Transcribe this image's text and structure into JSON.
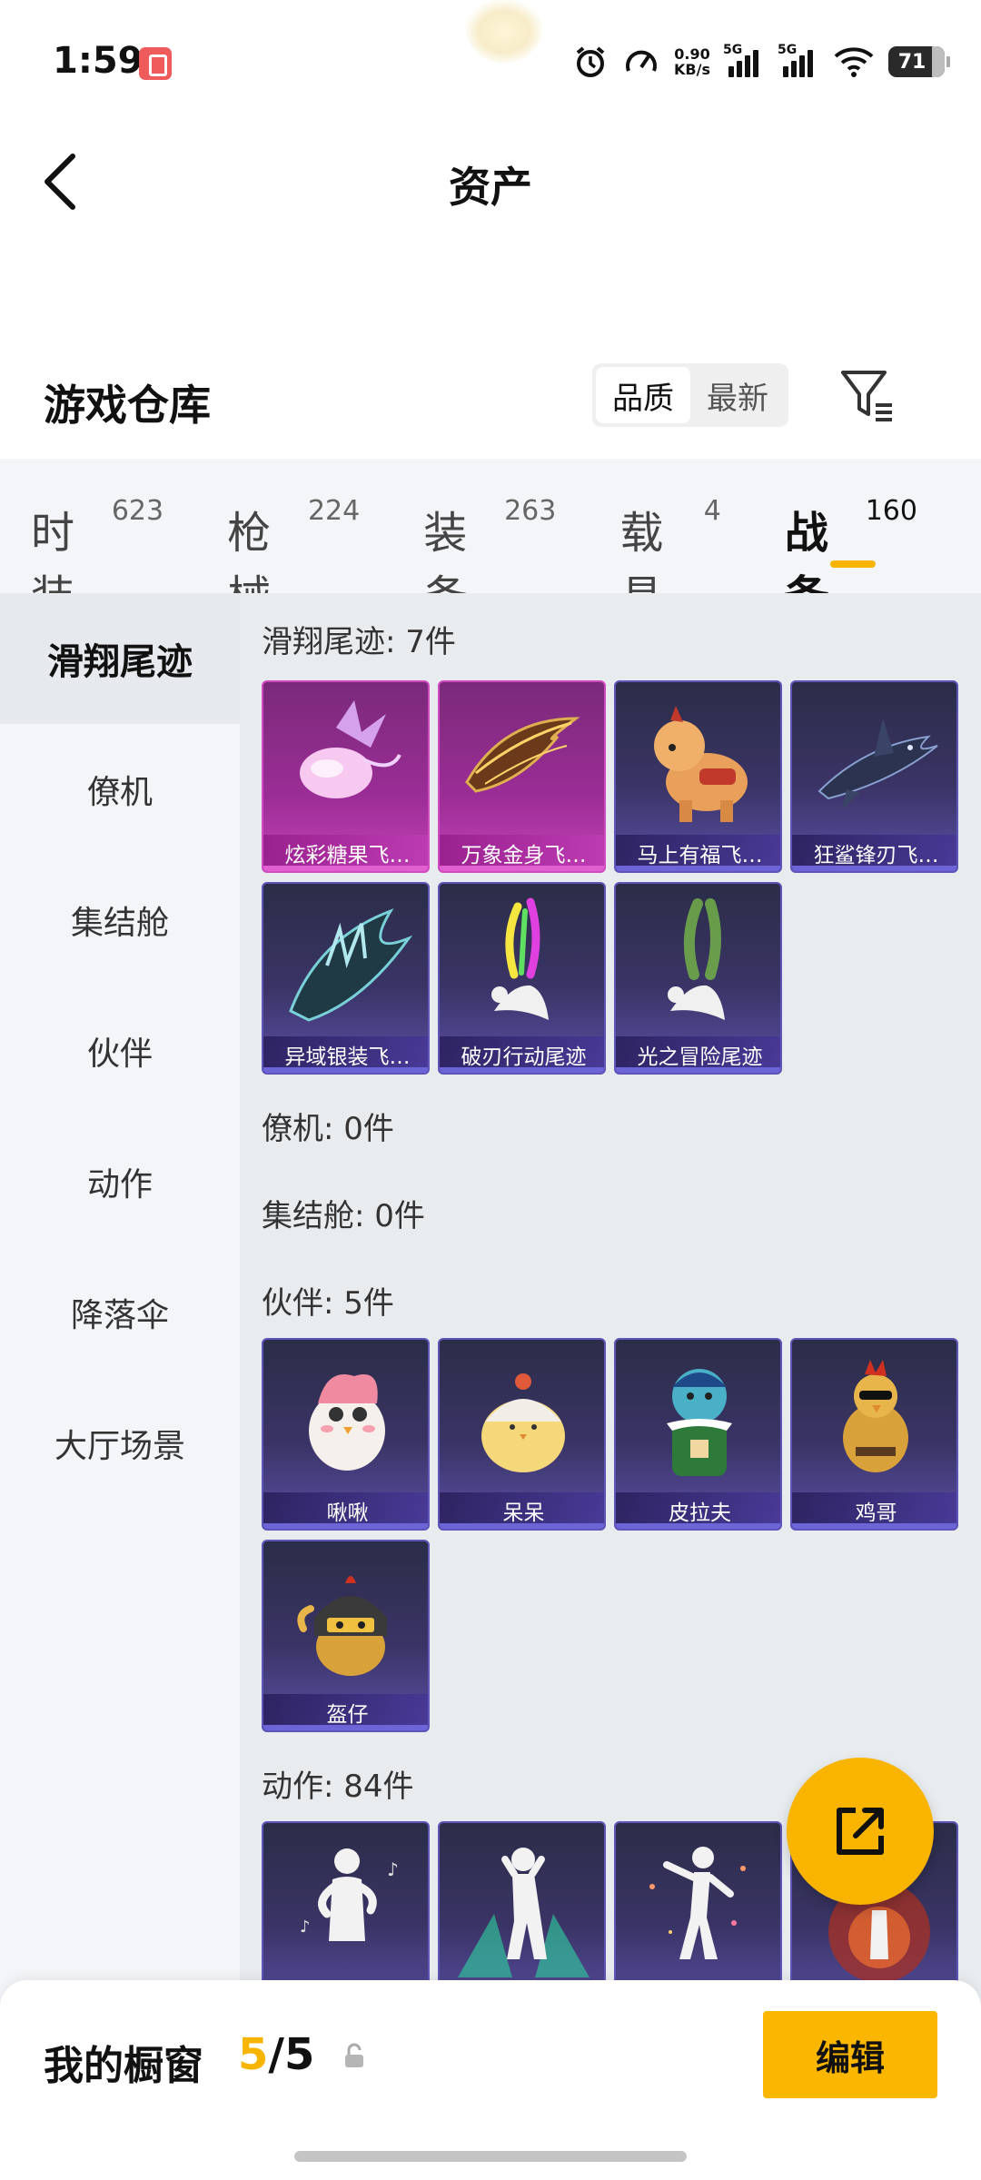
{
  "status_bar": {
    "time": "1:59",
    "net_speed_value": "0.90",
    "net_speed_unit": "KB/s",
    "signal1_label": "5G",
    "signal2_label": "5G",
    "battery": "71",
    "icons": [
      "app-notification-icon",
      "alarm-icon",
      "speedometer-icon",
      "signal-icon",
      "wifi-icon",
      "battery-icon"
    ]
  },
  "header": {
    "title": "资产",
    "back_icon": "chevron-left-icon"
  },
  "section": {
    "title": "游戏仓库",
    "sort_options": [
      "品质",
      "最新"
    ],
    "sort_selected": "品质",
    "filter_icon": "filter-icon"
  },
  "tabs": [
    {
      "label": "时装",
      "count": "623"
    },
    {
      "label": "枪械",
      "count": "224"
    },
    {
      "label": "装备",
      "count": "263"
    },
    {
      "label": "载具",
      "count": "4"
    },
    {
      "label": "战备",
      "count": "160",
      "active": true
    }
  ],
  "sidebar": {
    "items": [
      "滑翔尾迹",
      "僚机",
      "集结舱",
      "伙伴",
      "动作",
      "降落伞",
      "大厅场景"
    ],
    "active": "滑翔尾迹"
  },
  "groups": {
    "trails": {
      "title": "滑翔尾迹: 7件",
      "items": [
        "炫彩糖果飞…",
        "万象金身飞…",
        "马上有福飞…",
        "狂鲨锋刃飞…",
        "异域银装飞…",
        "破刃行动尾迹",
        "光之冒险尾迹"
      ]
    },
    "wingman": {
      "title": "僚机: 0件"
    },
    "pod": {
      "title": "集结舱: 0件"
    },
    "companion": {
      "title": "伙伴: 5件",
      "items": [
        "啾啾",
        "呆呆",
        "皮拉夫",
        "鸡哥",
        "盔仔"
      ]
    },
    "emote": {
      "title": "动作: 84件"
    }
  },
  "fab": {
    "icon": "share-external-icon"
  },
  "bottom_bar": {
    "label": "我的橱窗",
    "count_current": "5",
    "count_total": "/5",
    "lock_icon": "lock-icon",
    "edit_label": "编辑"
  },
  "colors": {
    "accent": "#f7b500",
    "card_purple": "#3a3466",
    "card_pink": "#9b2d96",
    "sidebar_bg": "#f3f5f8",
    "content_bg": "#e9ecef"
  }
}
